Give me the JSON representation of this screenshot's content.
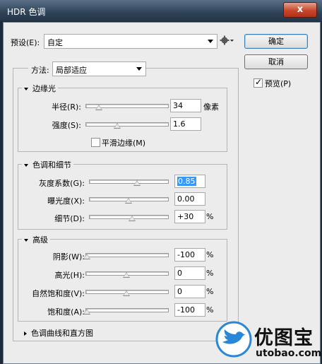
{
  "window": {
    "title": "HDR 色调",
    "close": "x"
  },
  "preset": {
    "label": "预设(E):",
    "value": "自定"
  },
  "buttons": {
    "ok": "确定",
    "cancel": "取消",
    "preview": "预览(P)",
    "preview_checked": true
  },
  "method": {
    "label": "方法:",
    "value": "局部适应"
  },
  "edge_glow": {
    "title": "边缘光",
    "radius": {
      "label": "半径(R):",
      "value": "34",
      "unit": "像素",
      "slider_pct": 0.15
    },
    "strength": {
      "label": "强度(S):",
      "value": "1.6",
      "slider_pct": 0.38
    },
    "smooth": {
      "label": "平滑边缘(M)",
      "checked": false
    }
  },
  "tone_detail": {
    "title": "色调和细节",
    "gamma": {
      "label": "灰度系数(G):",
      "value": "0.85",
      "slider_pct": 0.62
    },
    "exposure": {
      "label": "曝光度(X):",
      "value": "0.00",
      "slider_pct": 0.5
    },
    "detail": {
      "label": "细节(D):",
      "value": "+30",
      "unit": "%",
      "slider_pct": 0.55
    }
  },
  "advanced": {
    "title": "高级",
    "shadow": {
      "label": "阴影(W):",
      "value": "-100",
      "unit": "%",
      "slider_pct": 0.0
    },
    "highlight": {
      "label": "高光(H):",
      "value": "0",
      "unit": "%",
      "slider_pct": 0.5
    },
    "vibrance": {
      "label": "自然饱和度(V):",
      "value": "0",
      "unit": "%",
      "slider_pct": 0.5
    },
    "saturation": {
      "label": "饱和度(A):",
      "value": "-100",
      "unit": "%",
      "slider_pct": 0.0
    }
  },
  "curve": {
    "title": "色调曲线和直方图"
  },
  "watermark": {
    "text": "优图宝",
    "url": "utobao.com"
  },
  "colors": {
    "watermark_blue": "#2a86d6",
    "selection": "#3399ff"
  },
  "icons": {
    "gear": "gear-icon",
    "preset_menu": "chevron-down-icon"
  }
}
